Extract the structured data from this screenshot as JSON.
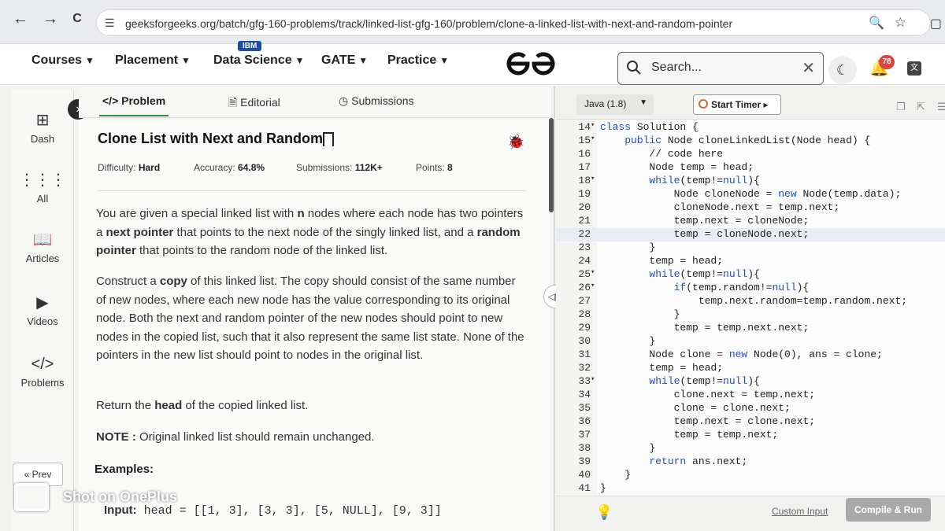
{
  "browser": {
    "back": "←",
    "forward": "→",
    "reload": "C",
    "url": "geeksforgeeks.org/batch/gfg-160-problems/track/linked-list-gfg-160/problem/clone-a-linked-list-with-next-and-random-pointer"
  },
  "header": {
    "menu": [
      {
        "label": "Courses"
      },
      {
        "label": "Placement"
      },
      {
        "label": "Data Science"
      },
      {
        "label": "GATE"
      },
      {
        "label": "Practice"
      }
    ],
    "ibm_badge": "IBM",
    "search_placeholder": "Search...",
    "notification_count": "78"
  },
  "sidebar": {
    "items": [
      {
        "label": "Dash"
      },
      {
        "label": "All"
      },
      {
        "label": "Articles"
      },
      {
        "label": "Videos"
      },
      {
        "label": "Problems"
      }
    ],
    "prev_label": "« Prev"
  },
  "tabs": {
    "problem": "Problem",
    "editorial": "Editorial",
    "submissions": "Submissions"
  },
  "problem": {
    "title": "Clone List with Next and Random",
    "difficulty_label": "Difficulty:",
    "difficulty": "Hard",
    "accuracy_label": "Accuracy:",
    "accuracy": "64.8%",
    "submissions_label": "Submissions:",
    "submissions": "112K+",
    "points_label": "Points:",
    "points": "8",
    "p1_a": "You are given a special linked list with ",
    "p1_b": "n",
    "p1_c": " nodes where each node has two pointers a ",
    "p1_d": "next pointer",
    "p1_e": " that points to the next node of the singly linked list, and a ",
    "p1_f": "random pointer",
    "p1_g": " that points to the random node of the linked list.",
    "p2_a": "Construct a ",
    "p2_b": "copy",
    "p2_c": " of this linked list. The copy should consist of the same number of new nodes, where each new node has the value corresponding to its original node. Both the next and random pointer of the new nodes should point to new nodes in the copied list, such that it also represent the same list state. None of the pointers in the new list should point to nodes in the original list.",
    "p3_a": "Return the ",
    "p3_b": "head",
    "p3_c": " of the copied linked list.",
    "note_label": "NOTE :",
    "note_text": " Original linked list should remain unchanged.",
    "examples_label": "Examples:",
    "input_label": "Input:",
    "input_value": " head = [[1, 3], [3, 3], [5, NULL], [9, 3]]"
  },
  "editor": {
    "language": "Java (1.8)",
    "timer_label": "Start Timer",
    "custom_input": "Custom Input",
    "compile_label": "Compile & Run",
    "lines": [
      {
        "n": "14",
        "fold": true,
        "hl": false,
        "text": "class Solution {"
      },
      {
        "n": "15",
        "fold": true,
        "hl": false,
        "text": "    public Node cloneLinkedList(Node head) {"
      },
      {
        "n": "16",
        "fold": false,
        "hl": false,
        "text": "        // code here"
      },
      {
        "n": "17",
        "fold": false,
        "hl": false,
        "text": "        Node temp = head;"
      },
      {
        "n": "18",
        "fold": true,
        "hl": false,
        "text": "        while(temp!=null){"
      },
      {
        "n": "19",
        "fold": false,
        "hl": false,
        "text": "            Node cloneNode = new Node(temp.data);"
      },
      {
        "n": "20",
        "fold": false,
        "hl": false,
        "text": "            cloneNode.next = temp.next;"
      },
      {
        "n": "21",
        "fold": false,
        "hl": false,
        "text": "            temp.next = cloneNode;"
      },
      {
        "n": "22",
        "fold": false,
        "hl": true,
        "text": "            temp = cloneNode.next;"
      },
      {
        "n": "23",
        "fold": false,
        "hl": false,
        "text": "        }"
      },
      {
        "n": "24",
        "fold": false,
        "hl": false,
        "text": "        temp = head;"
      },
      {
        "n": "25",
        "fold": true,
        "hl": false,
        "text": "        while(temp!=null){"
      },
      {
        "n": "26",
        "fold": true,
        "hl": false,
        "text": "            if(temp.random!=null){"
      },
      {
        "n": "27",
        "fold": false,
        "hl": false,
        "text": "                temp.next.random=temp.random.next;"
      },
      {
        "n": "28",
        "fold": false,
        "hl": false,
        "text": "            }"
      },
      {
        "n": "29",
        "fold": false,
        "hl": false,
        "text": "            temp = temp.next.next;"
      },
      {
        "n": "30",
        "fold": false,
        "hl": false,
        "text": "        }"
      },
      {
        "n": "31",
        "fold": false,
        "hl": false,
        "text": "        Node clone = new Node(0), ans = clone;"
      },
      {
        "n": "32",
        "fold": false,
        "hl": false,
        "text": "        temp = head;"
      },
      {
        "n": "33",
        "fold": true,
        "hl": false,
        "text": "        while(temp!=null){"
      },
      {
        "n": "34",
        "fold": false,
        "hl": false,
        "text": "            clone.next = temp.next;"
      },
      {
        "n": "35",
        "fold": false,
        "hl": false,
        "text": "            clone = clone.next;"
      },
      {
        "n": "36",
        "fold": false,
        "hl": false,
        "text": "            temp.next = clone.next;"
      },
      {
        "n": "37",
        "fold": false,
        "hl": false,
        "text": "            temp = temp.next;"
      },
      {
        "n": "38",
        "fold": false,
        "hl": false,
        "text": "        }"
      },
      {
        "n": "39",
        "fold": false,
        "hl": false,
        "text": "        return ans.next;"
      },
      {
        "n": "40",
        "fold": false,
        "hl": false,
        "text": "    }"
      },
      {
        "n": "41",
        "fold": false,
        "hl": false,
        "text": "}"
      }
    ]
  },
  "watermark": "Shot on OnePlus",
  "colors": {
    "accent_green": "#2f8d46",
    "keyword_blue": "#1f4fbf",
    "notification_red": "#d44444"
  }
}
